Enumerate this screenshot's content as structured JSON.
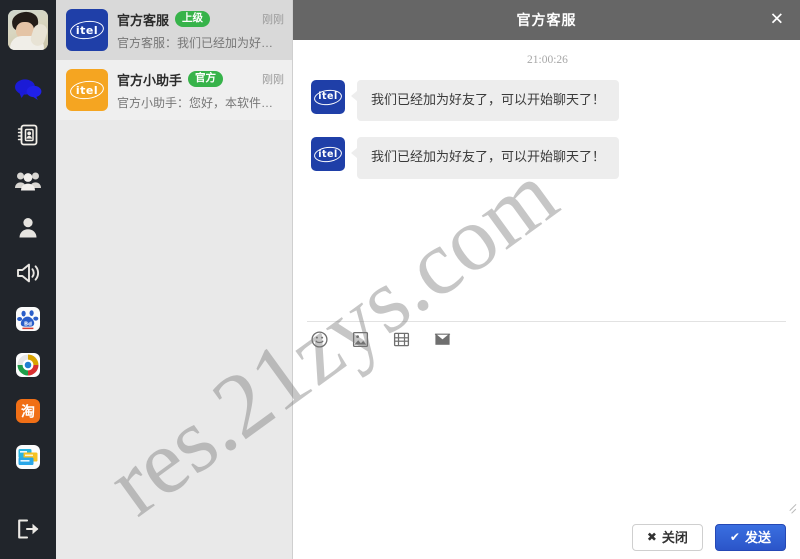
{
  "colors": {
    "rail_bg": "#21252b",
    "list_bg": "#e9e9e9",
    "selected_bg": "#d9d9d9",
    "titlebar_bg": "#666666",
    "badge_green": "#37b34a",
    "avatar_blue": "#1f3fa8",
    "avatar_orange": "#f5a521",
    "send_blue": "#2b55c9",
    "bubble_gray": "#ededed"
  },
  "rail": {
    "avatar_name": "user-photo-avatar",
    "items": [
      {
        "icon": "chat-bubbles-icon",
        "name": "rail-item-chat",
        "active": true
      },
      {
        "icon": "address-book-icon",
        "name": "rail-item-contacts",
        "active": false
      },
      {
        "icon": "group-people-icon",
        "name": "rail-item-groups",
        "active": false
      },
      {
        "icon": "person-icon",
        "name": "rail-item-profile",
        "active": false
      },
      {
        "icon": "speaker-megaphone-icon",
        "name": "rail-item-announcements",
        "active": false
      },
      {
        "icon": "baidu-app-icon",
        "name": "rail-item-baidu",
        "active": false
      },
      {
        "icon": "browser-app-icon",
        "name": "rail-item-browser",
        "active": false
      },
      {
        "icon": "taobao-app-icon",
        "name": "rail-item-taobao",
        "active": false
      },
      {
        "icon": "cards-app-icon",
        "name": "rail-item-cards",
        "active": false
      }
    ],
    "logout_icon": "logout-arrow-icon"
  },
  "contacts": {
    "items": [
      {
        "name": "官方客服",
        "badge": "上级",
        "time": "刚刚",
        "snippet": "官方客服：我们已经加为好友了…",
        "avatar_text": "itel",
        "avatar_color": "#1f3fa8",
        "selected": true
      },
      {
        "name": "官方小助手",
        "badge": "官方",
        "time": "刚刚",
        "snippet": "官方小助手：您好，本软件正在…",
        "avatar_text": "itel",
        "avatar_color": "#f5a521",
        "selected": false
      }
    ]
  },
  "chat": {
    "title": "官方客服",
    "close_icon": "close-icon",
    "timestamp": "21:00:26",
    "messages": [
      {
        "sender": "官方客服",
        "avatar_text": "itel",
        "text": "我们已经加为好友了，可以开始聊天了！"
      },
      {
        "sender": "官方客服",
        "avatar_text": "itel",
        "text": "我们已经加为好友了，可以开始聊天了！"
      }
    ],
    "toolbar": [
      {
        "icon": "emoji-smiley-icon",
        "name": "toolbar-emoji"
      },
      {
        "icon": "image-picture-icon",
        "name": "toolbar-image"
      },
      {
        "icon": "video-film-icon",
        "name": "toolbar-video"
      },
      {
        "icon": "envelope-mail-icon",
        "name": "toolbar-file"
      }
    ],
    "input": {
      "value": "",
      "placeholder": ""
    },
    "buttons": {
      "close_label": "关闭",
      "close_glyph": "✖",
      "send_label": "发送",
      "send_glyph": "✔"
    }
  },
  "watermark": {
    "text": "res.21zys.com"
  }
}
